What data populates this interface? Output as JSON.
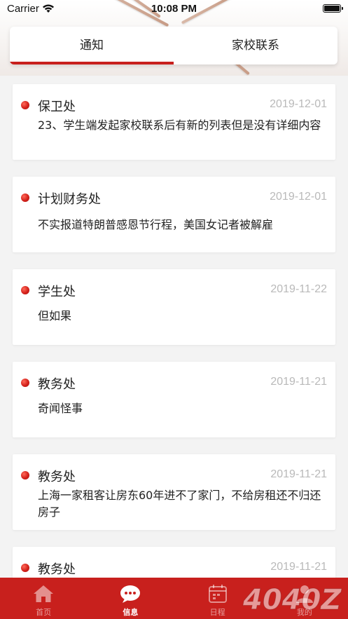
{
  "status_bar": {
    "carrier": "Carrier",
    "time": "10:08 PM"
  },
  "tabs": [
    {
      "label": "通知",
      "active": true
    },
    {
      "label": "家校联系",
      "active": false
    }
  ],
  "notices": [
    {
      "dept": "保卫处",
      "date": "2019-12-01",
      "content": "23、学生端发起家校联系后有新的列表但是没有详细内容"
    },
    {
      "dept": "计划财务处",
      "date": "2019-12-01",
      "content": "不实报道特朗普感恩节行程，美国女记者被解雇"
    },
    {
      "dept": "学生处",
      "date": "2019-11-22",
      "content": "但如果"
    },
    {
      "dept": "教务处",
      "date": "2019-11-21",
      "content": "奇闻怪事"
    },
    {
      "dept": "教务处",
      "date": "2019-11-21",
      "content": "上海一家租客让房东60年进不了家门，不给房租还不归还房子"
    },
    {
      "dept": "教务处",
      "date": "2019-11-21",
      "content": ""
    }
  ],
  "tabbar": [
    {
      "label": "首页",
      "icon": "home-icon",
      "active": false
    },
    {
      "label": "信息",
      "icon": "chat-bubble-icon",
      "active": true
    },
    {
      "label": "日程",
      "icon": "calendar-icon",
      "active": false
    },
    {
      "label": "我的",
      "icon": "user-icon",
      "active": false
    }
  ],
  "watermark": {
    "text": "4040Z"
  },
  "colors": {
    "accent": "#c8201d",
    "date_gray": "#b9b9b9",
    "background": "#f3f3f3"
  }
}
